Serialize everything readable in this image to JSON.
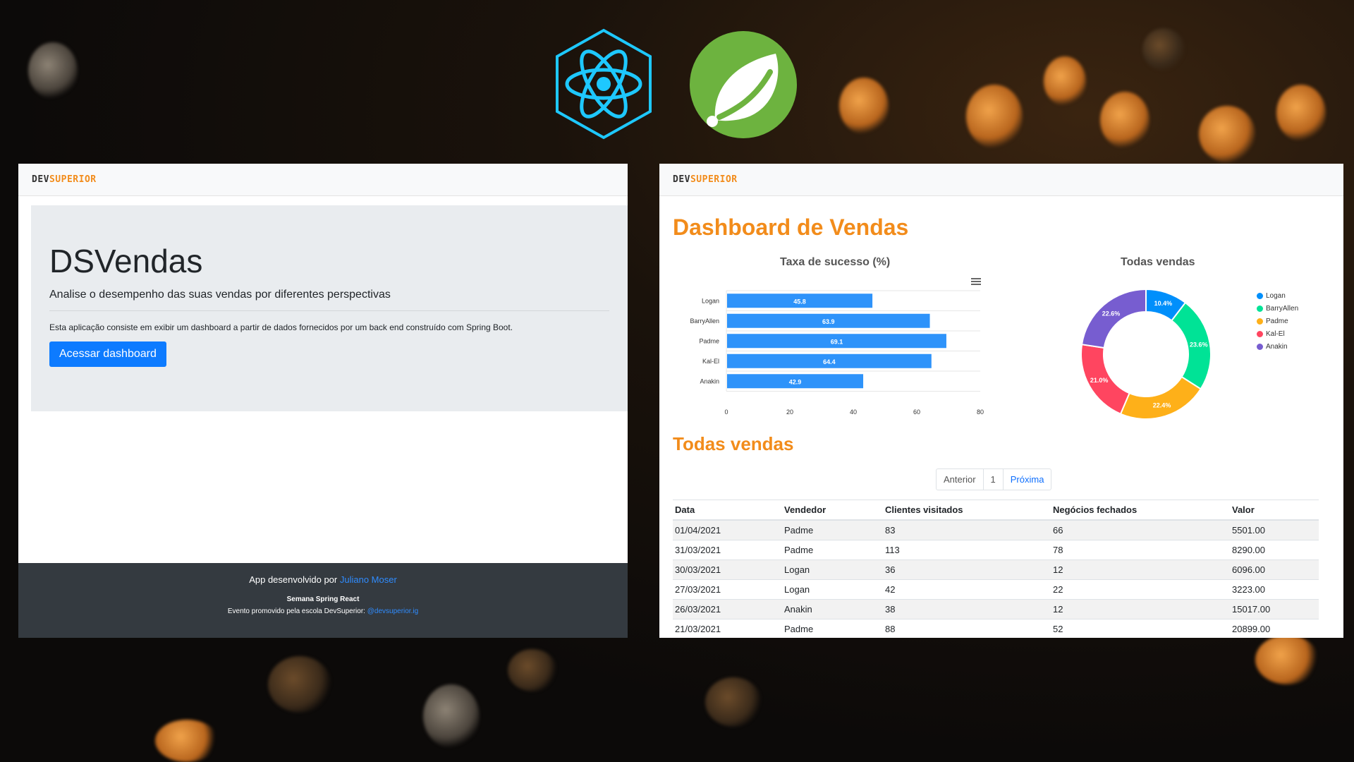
{
  "left_app": {
    "brand": {
      "dev": "DEV",
      "superior": "SUPERIOR"
    },
    "title": "DSVendas",
    "lead": "Analise o desempenho das suas vendas por diferentes perspectivas",
    "description": "Esta aplicação consiste em exibir um dashboard a partir de dados fornecidos por um back end construído com Spring Boot.",
    "button_label": "Acessar dashboard",
    "footer": {
      "line1_prefix": "App desenvolvido por ",
      "line1_link": "Juliano Moser",
      "line2": "Semana Spring React",
      "line3_prefix": "Evento promovido pela escola DevSuperior: ",
      "line3_link": "@devsuperior.ig"
    }
  },
  "right_app": {
    "brand": {
      "dev": "DEV",
      "superior": "SUPERIOR"
    },
    "title": "Dashboard de Vendas",
    "bar_chart_title": "Taxa de sucesso (%)",
    "donut_chart_title": "Todas vendas",
    "table_title": "Todas vendas",
    "pagination": {
      "prev": "Anterior",
      "page": "1",
      "next": "Próxima"
    },
    "table": {
      "headers": [
        "Data",
        "Vendedor",
        "Clientes visitados",
        "Negócios fechados",
        "Valor"
      ],
      "rows": [
        [
          "01/04/2021",
          "Padme",
          "83",
          "66",
          "5501.00"
        ],
        [
          "31/03/2021",
          "Padme",
          "113",
          "78",
          "8290.00"
        ],
        [
          "30/03/2021",
          "Logan",
          "36",
          "12",
          "6096.00"
        ],
        [
          "27/03/2021",
          "Logan",
          "42",
          "22",
          "3223.00"
        ],
        [
          "26/03/2021",
          "Anakin",
          "38",
          "12",
          "15017.00"
        ],
        [
          "21/03/2021",
          "Padme",
          "88",
          "52",
          "20899.00"
        ]
      ]
    }
  },
  "chart_data": [
    {
      "type": "bar",
      "title": "Taxa de sucesso (%)",
      "orientation": "horizontal",
      "categories": [
        "Logan",
        "BarryAllen",
        "Padme",
        "Kal-El",
        "Anakin"
      ],
      "values": [
        45.8,
        63.9,
        69.1,
        64.4,
        42.9
      ],
      "xlim": [
        0,
        80
      ],
      "ticks": [
        0,
        20,
        40,
        60,
        80
      ],
      "color": "#2e93fa"
    },
    {
      "type": "pie",
      "subtype": "donut",
      "title": "Todas vendas",
      "labels": [
        "Logan",
        "BarryAllen",
        "Padme",
        "Kal-El",
        "Anakin"
      ],
      "values": [
        10.4,
        23.6,
        22.4,
        21.0,
        22.6
      ],
      "value_labels": [
        "10.4%",
        "23.6%",
        "22.4%",
        "21.0%",
        "22.6%"
      ],
      "colors": [
        "#008ffb",
        "#00e396",
        "#feb019",
        "#ff4560",
        "#775dd0"
      ],
      "legend": "right"
    }
  ]
}
